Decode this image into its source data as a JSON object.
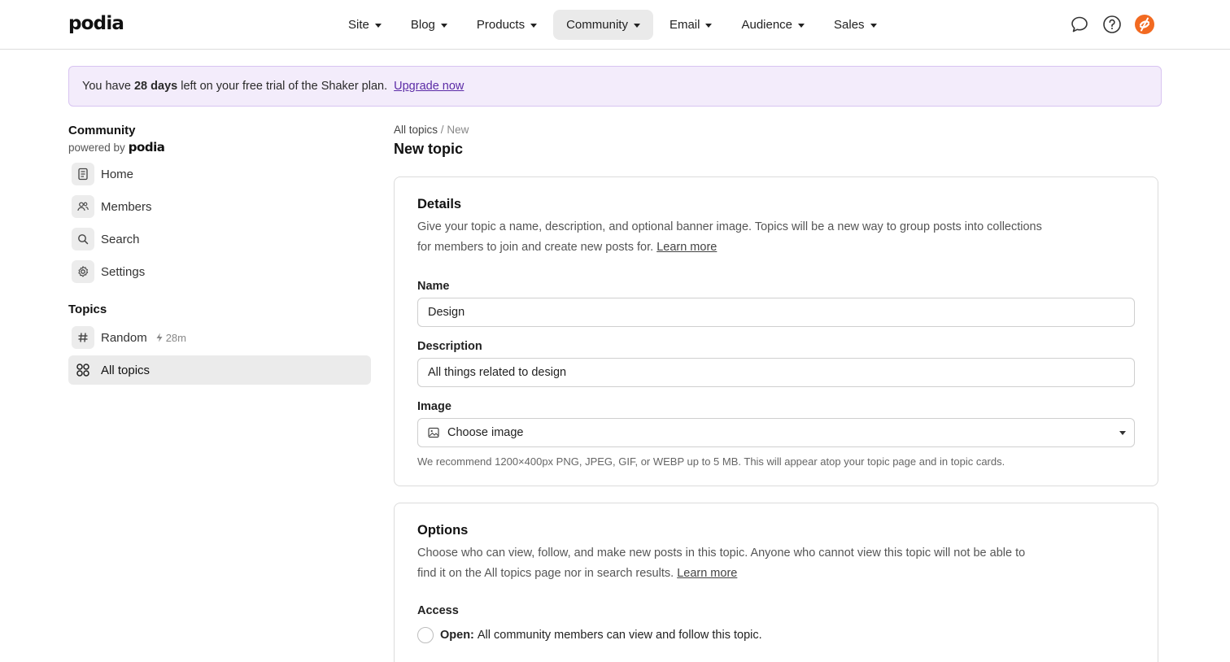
{
  "brand": {
    "logo": "podia"
  },
  "nav": {
    "items": [
      {
        "label": "Site"
      },
      {
        "label": "Blog"
      },
      {
        "label": "Products"
      },
      {
        "label": "Community",
        "active": true
      },
      {
        "label": "Email"
      },
      {
        "label": "Audience"
      },
      {
        "label": "Sales"
      }
    ],
    "icons": [
      "chat-bubble-icon",
      "help-circle-icon",
      "user-avatar-icon"
    ],
    "accent": "#f26a21"
  },
  "banner": {
    "prefix": "You have",
    "days": "28 days",
    "suffix": "left on your free trial of the Shaker plan.",
    "cta": "Upgrade now",
    "bg": "#f3ecfb",
    "link_color": "#5b2ba6"
  },
  "sidebar": {
    "title": "Community",
    "powered_prefix": "powered by",
    "powered_logo": "podia",
    "items": [
      {
        "label": "Home",
        "icon": "newspaper-icon"
      },
      {
        "label": "Members",
        "icon": "members-icon"
      },
      {
        "label": "Search",
        "icon": "search-icon"
      },
      {
        "label": "Settings",
        "icon": "gear-icon"
      }
    ],
    "topics_heading": "Topics",
    "topics": [
      {
        "label": "Random",
        "icon": "hash-icon",
        "meta": "28m",
        "meta_icon": "bolt-icon"
      },
      {
        "label": "All topics",
        "icon": "grid-icon",
        "active": true
      }
    ]
  },
  "breadcrumb": {
    "parent": "All topics",
    "separator": "/",
    "current": "New"
  },
  "page_title": "New topic",
  "details": {
    "title": "Details",
    "description": "Give your topic a name, description, and optional banner image. Topics will be a new way to group posts into collections for members to join and create new posts for.",
    "learn_more": "Learn more",
    "name_label": "Name",
    "name_value": "Design",
    "description_label": "Description",
    "description_value": "All things related to design",
    "image_label": "Image",
    "image_select": "Choose image",
    "image_hint": "We recommend 1200×400px PNG, JPEG, GIF, or WEBP up to 5 MB. This will appear atop your topic page and in topic cards."
  },
  "options": {
    "title": "Options",
    "description": "Choose who can view, follow, and make new posts in this topic. Anyone who cannot view this topic will not be able to find it on the All topics page nor in search results.",
    "learn_more": "Learn more",
    "access_label": "Access",
    "radios": [
      {
        "label": "Open:",
        "text": "All community members can view and follow this topic."
      }
    ]
  }
}
